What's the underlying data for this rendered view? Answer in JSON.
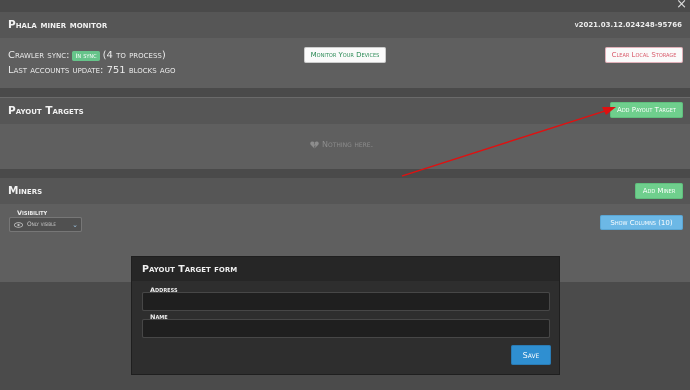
{
  "monitor": {
    "title": "Phala miner monitor",
    "version": "v2021.03.12.024248-95766",
    "sync_label": "Crawler sync:",
    "sync_badge": "In sync",
    "sync_detail": "(4 to process)",
    "accounts_update": "Last accounts update: 751 blocks ago",
    "monitor_button": "Monitor Your Devices",
    "clear_button": "Clear Local Storage",
    "close_glyph": "×"
  },
  "payout": {
    "title": "Payout Targets",
    "add_button": "Add Payout Target",
    "empty_text": "Nothing here.",
    "empty_icon": "broken-heart-icon"
  },
  "miners": {
    "title": "Miners",
    "add_button": "Add Miner",
    "visibility_label": "Visibility",
    "visibility_value": "Only visible",
    "columns_button": "Show Columns (10)"
  },
  "modal": {
    "title": "Payout Target form",
    "address_label": "Address",
    "address_value": "",
    "name_label": "Name",
    "name_value": "",
    "save_button": "Save"
  },
  "colors": {
    "accent_green": "#6fcf8d",
    "accent_blue": "#2f8fd1",
    "annotation_red": "#e01010"
  }
}
